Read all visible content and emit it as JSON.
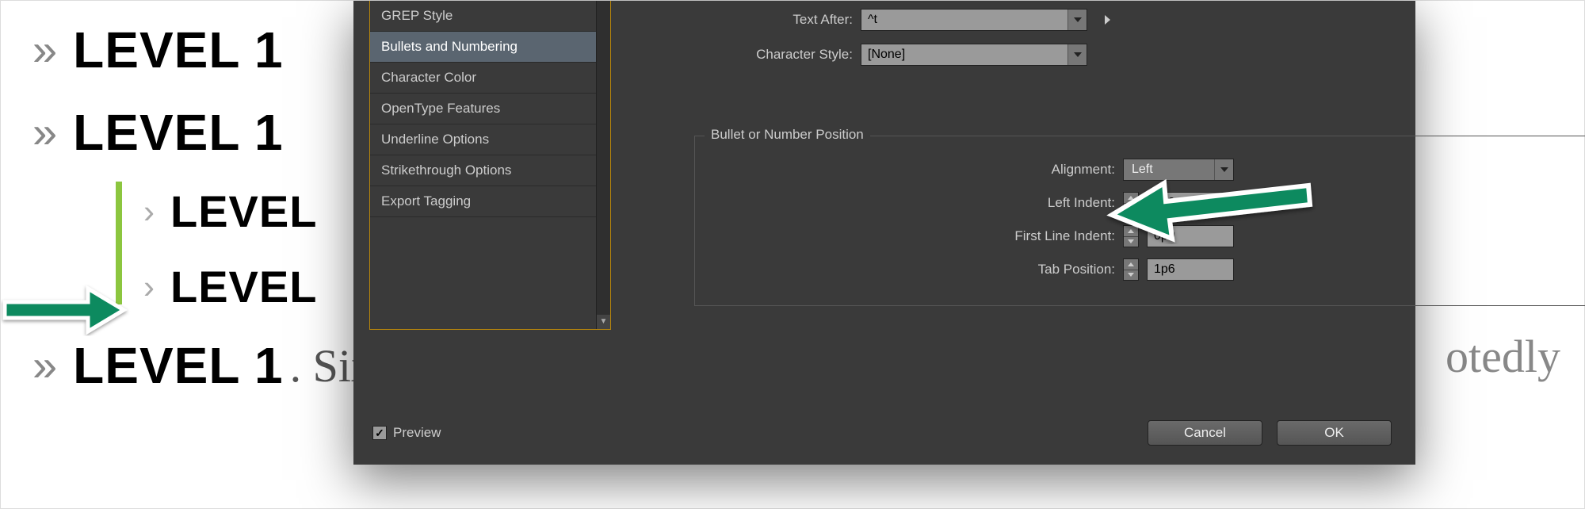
{
  "document": {
    "rows": [
      {
        "bullet": "»",
        "text": "LEVEL 1",
        "level": 1
      },
      {
        "bullet": "»",
        "text": "LEVEL 1",
        "level": 1
      },
      {
        "bullet": "›",
        "text": "LEVEL",
        "level": 2
      },
      {
        "bullet": "›",
        "text": "LEVEL",
        "level": 2
      },
      {
        "bullet": "»",
        "text": "LEVEL 1",
        "level": 1,
        "suffix": ". Six is an even number."
      }
    ],
    "background_word_right": "otedly"
  },
  "sidebar": {
    "items": [
      {
        "label": "GREP Style",
        "selected": false
      },
      {
        "label": "Bullets and Numbering",
        "selected": true
      },
      {
        "label": "Character Color",
        "selected": false
      },
      {
        "label": "OpenType Features",
        "selected": false
      },
      {
        "label": "Underline Options",
        "selected": false
      },
      {
        "label": "Strikethrough Options",
        "selected": false
      },
      {
        "label": "Export Tagging",
        "selected": false
      }
    ]
  },
  "top_fields": {
    "text_after": {
      "label": "Text After:",
      "value": "^t"
    },
    "character_style": {
      "label": "Character Style:",
      "value": "[None]"
    }
  },
  "fieldset": {
    "title": "Bullet or Number Position",
    "alignment": {
      "label": "Alignment:",
      "value": "Left"
    },
    "left_indent": {
      "label": "Left Indent:",
      "value": "1p0"
    },
    "first_line_indent": {
      "label": "First Line Indent:",
      "value": "0p0"
    },
    "tab_position": {
      "label": "Tab Position:",
      "value": "1p6"
    }
  },
  "footer": {
    "preview_label": "Preview",
    "preview_checked": true,
    "cancel_label": "Cancel",
    "ok_label": "OK"
  },
  "annotations": {
    "arrow_color": "#0a8a5f"
  }
}
